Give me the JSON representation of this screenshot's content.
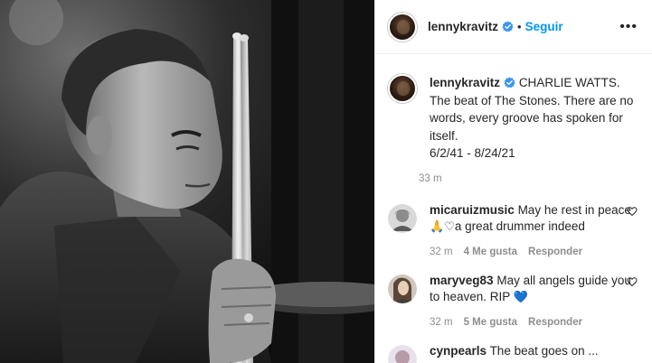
{
  "post": {
    "username": "lennykravitz",
    "follow_label": "Seguir",
    "more_label": "•••",
    "caption_text": "CHARLIE WATTS. The beat of The Stones. There are no words, every groove has spoken for itself.",
    "caption_dates": "6/2/41 - 8/24/21",
    "time_ago": "33 m"
  },
  "comments": [
    {
      "username": "micaruizmusic",
      "text_a": "May he rest in peace",
      "emoji_a": "🙏",
      "emoji_b": "♡",
      "text_b": "a great drummer indeed",
      "time": "32 m",
      "likes": "4 Me gusta",
      "reply": "Responder"
    },
    {
      "username": "maryveg83",
      "text_a": "May all angels guide you to heaven. RIP",
      "emoji_a": "💙",
      "time": "32 m",
      "likes": "5 Me gusta",
      "reply": "Responder"
    },
    {
      "username": "cynpearls",
      "text_a": "The beat goes on ..."
    }
  ],
  "colors": {
    "link_blue": "#0095f6",
    "verified_blue": "#3897f0",
    "muted_text": "#8e8e8e"
  },
  "icons": [
    "verified-badge-icon",
    "heart-outline-icon",
    "more-options-icon"
  ]
}
